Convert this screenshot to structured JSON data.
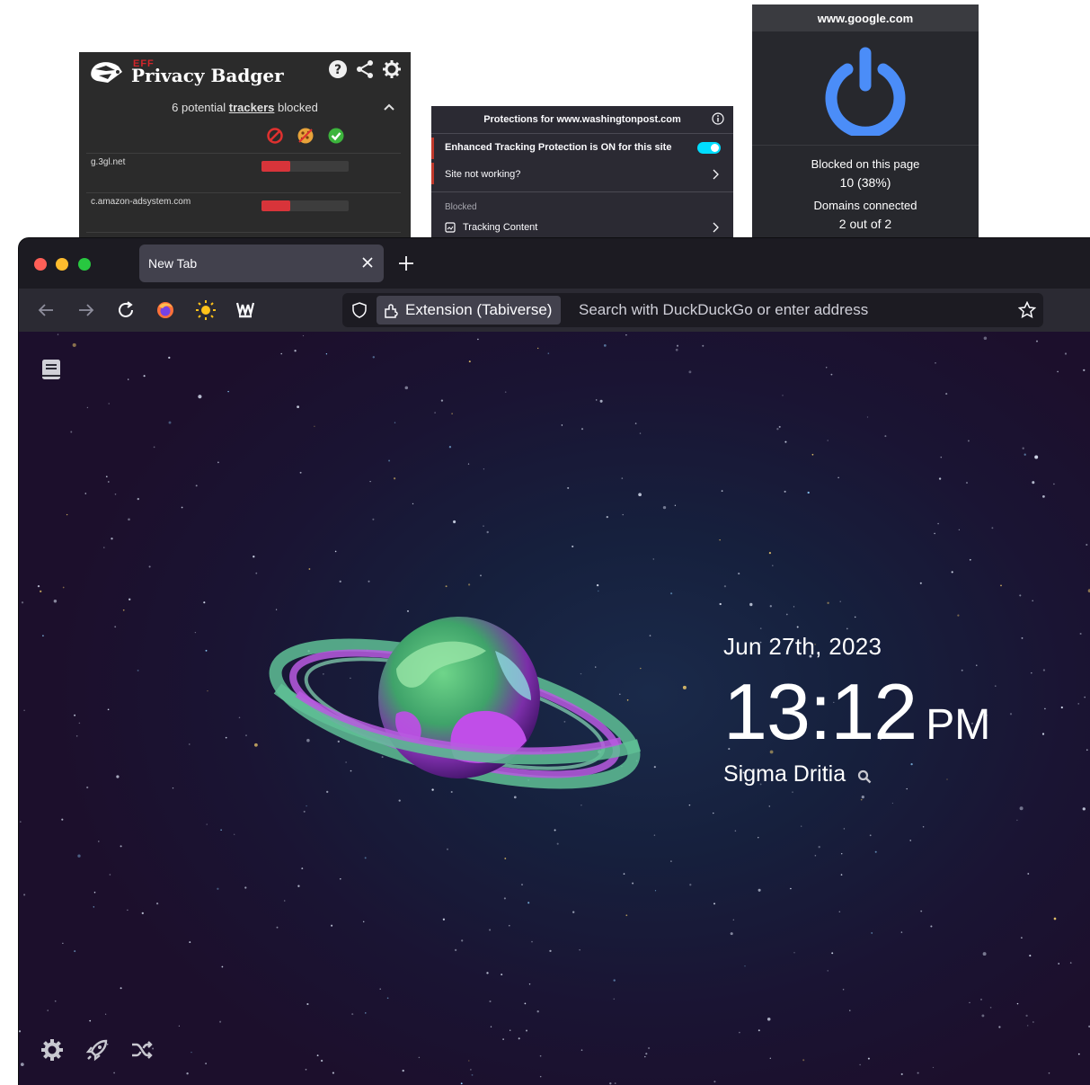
{
  "privacy_badger": {
    "brand_prefix": "EFF",
    "title": "Privacy Badger",
    "summary_count_text": "6 potential",
    "summary_link": "trackers",
    "summary_suffix": "blocked",
    "icons": [
      "help-icon",
      "share-icon",
      "gear-icon"
    ],
    "legend_icons": [
      "block-icon",
      "cookie-icon",
      "allow-icon"
    ],
    "trackers": [
      {
        "domain": "g.3gl.net",
        "slider_level": 0.33
      },
      {
        "domain": "c.amazon-adsystem.com",
        "slider_level": 0.33
      }
    ]
  },
  "firefox_protections": {
    "title": "Protections for www.washingtonpost.com",
    "etp_label": "Enhanced Tracking Protection is ON for this site",
    "etp_on": true,
    "site_not_working": "Site not working?",
    "blocked_label": "Blocked",
    "blocked_items": [
      "Tracking Content"
    ]
  },
  "ddg_popup": {
    "domain": "www.google.com",
    "blocked_label": "Blocked on this page",
    "blocked_value": "10 (38%)",
    "domains_label": "Domains connected",
    "domains_value": "2 out of 2",
    "accent": "#4b8df8"
  },
  "browser": {
    "tab": {
      "title": "New Tab"
    },
    "urlbar": {
      "extension_chip": "Extension (Tabiverse)",
      "placeholder": "Search with DuckDuckGo or enter address"
    },
    "toolbar_icons": [
      "back-icon",
      "forward-icon",
      "reload-icon",
      "firefox-icon",
      "sun-icon",
      "tabiverse-icon"
    ]
  },
  "newtab": {
    "date": "Jun 27th, 2023",
    "time": "13:12",
    "ampm": "PM",
    "location": "Sigma Dritia",
    "bottom_icons": [
      "settings-icon",
      "rocket-icon",
      "shuffle-icon"
    ],
    "colors": {
      "planet_land": "#b44ee0",
      "planet_ring": "#7fd8a8",
      "background": "#16203d"
    }
  }
}
